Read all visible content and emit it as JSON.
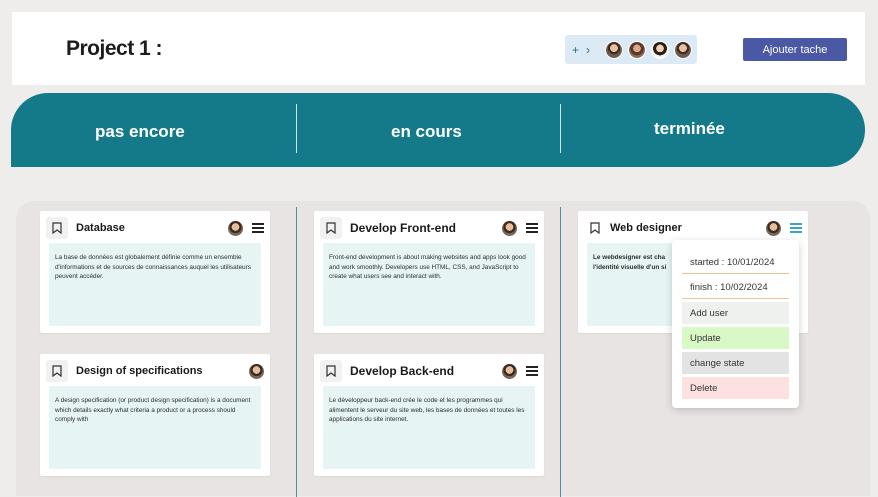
{
  "header": {
    "project_title": "Project 1 :",
    "members_plus": "+",
    "members_chevron": "›",
    "add_task_label": "Ajouter tache"
  },
  "status": {
    "col1": "pas encore",
    "col2": "en cours",
    "col3": "terminée"
  },
  "cards": {
    "database": {
      "title": "Database",
      "body": "La base de données est globalement définie comme un ensemble d'informations et de sources de connaissances auquel les utilisateurs peuvent accéder."
    },
    "specs": {
      "title": "Design of specifications",
      "body": "A design specification (or product design specification) is a document which details exactly what criteria a product or a process should comply with"
    },
    "frontend": {
      "title": "Develop Front-end",
      "body": "Front-end development is about making websites and apps look good and work smoothly. Developers use HTML, CSS, and JavaScript to create what users see and interact with."
    },
    "backend": {
      "title": "Develop Back-end",
      "body": "Le développeur back-end crée le code et les programmes qui alimentent le serveur du site web, les bases de données et toutes les applications du site internet."
    },
    "webdesigner": {
      "title": "Web designer",
      "body": "Le webdesigner est cha l'identité visuelle d'un si"
    }
  },
  "menu": {
    "started": "started : 10/01/2024",
    "finish": "finish : 10/02/2024",
    "add_user": "Add user",
    "update": "Update",
    "change_state": "change state",
    "delete": "Delete",
    "colors": {
      "add_user": "#eef1ee",
      "update": "#d8f9c6",
      "change_state": "#e3e3e3",
      "delete": "#fde0e0"
    }
  }
}
